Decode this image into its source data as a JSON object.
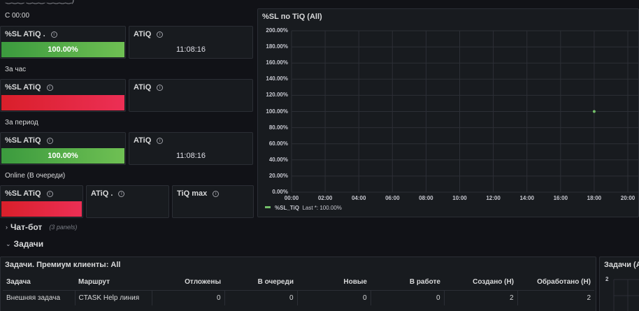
{
  "header": {
    "title_partial": "‿‿‿ ‿‿‿ ‿‿‿‿)"
  },
  "sections": {
    "since_midnight": "С 00:00",
    "last_hour": "За час",
    "period": "За период",
    "online": "Online (В очереди)"
  },
  "panels": {
    "sl1": {
      "title": "%SL ATiQ .",
      "value": "100.00%"
    },
    "atiq1": {
      "title": "ATiQ",
      "value": "11:08:16"
    },
    "sl2": {
      "title": "%SL ATiQ",
      "value": ""
    },
    "atiq2": {
      "title": "ATiQ",
      "value": ""
    },
    "sl3": {
      "title": "%SL ATiQ",
      "value": "100.00%"
    },
    "atiq3": {
      "title": "ATiQ",
      "value": "11:08:16"
    },
    "sl4": {
      "title": "%SL ATiQ",
      "value": ""
    },
    "atiq4": {
      "title": "ATiQ .",
      "value": ""
    },
    "tiqmax": {
      "title": "TiQ max",
      "value": ""
    }
  },
  "info_glyph": "i",
  "chart_data": {
    "type": "scatter",
    "title": "%SL по TiQ (All)",
    "y_ticks": [
      "200.00%",
      "180.00%",
      "160.00%",
      "140.00%",
      "120.00%",
      "100.00%",
      "80.00%",
      "60.00%",
      "40.00%",
      "20.00%",
      "0.00%"
    ],
    "x_ticks": [
      "00:00",
      "02:00",
      "04:00",
      "06:00",
      "08:00",
      "10:00",
      "12:00",
      "14:00",
      "16:00",
      "18:00",
      "20:00"
    ],
    "ylim": [
      0,
      200
    ],
    "xlim": [
      0,
      20
    ],
    "series": [
      {
        "name": "%SL_TiQ",
        "color": "#73bf69",
        "points": [
          {
            "x": 18,
            "y": 100
          }
        ]
      }
    ],
    "legend": {
      "label": "%SL_TiQ",
      "stat": "Last *: 100.00%"
    },
    "grid": true
  },
  "rows": {
    "chatbot": {
      "title": "Чат-бот",
      "sub": "(3 panels)",
      "chev": "›"
    },
    "tasks": {
      "title": "Задачи",
      "chev": "⌄"
    }
  },
  "tasks_table": {
    "title": "Задачи. Премиум клиенты: All",
    "columns": [
      "Задача",
      "Маршрут",
      "Отложены",
      "В очереди",
      "Новые",
      "В работе",
      "Создано (Н)",
      "Обработано (Н)"
    ],
    "rows": [
      [
        "Внешняя задача",
        "CTASK Help линия",
        "0",
        "0",
        "0",
        "0",
        "2",
        "2"
      ]
    ]
  },
  "right_panel": {
    "title": "Задачи (All",
    "y_tick": "2"
  }
}
